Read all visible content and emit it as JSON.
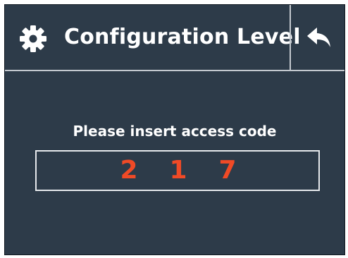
{
  "header": {
    "title": "Configuration Level",
    "icon": "gear-icon",
    "back_icon": "back-arrow-icon"
  },
  "access_code": {
    "prompt": "Please insert access code",
    "digits": [
      "2",
      "1",
      "7"
    ]
  },
  "colors": {
    "background": "#2d3b49",
    "text": "#ffffff",
    "code_digits": "#f04a26",
    "divider": "#c4c9cf"
  }
}
